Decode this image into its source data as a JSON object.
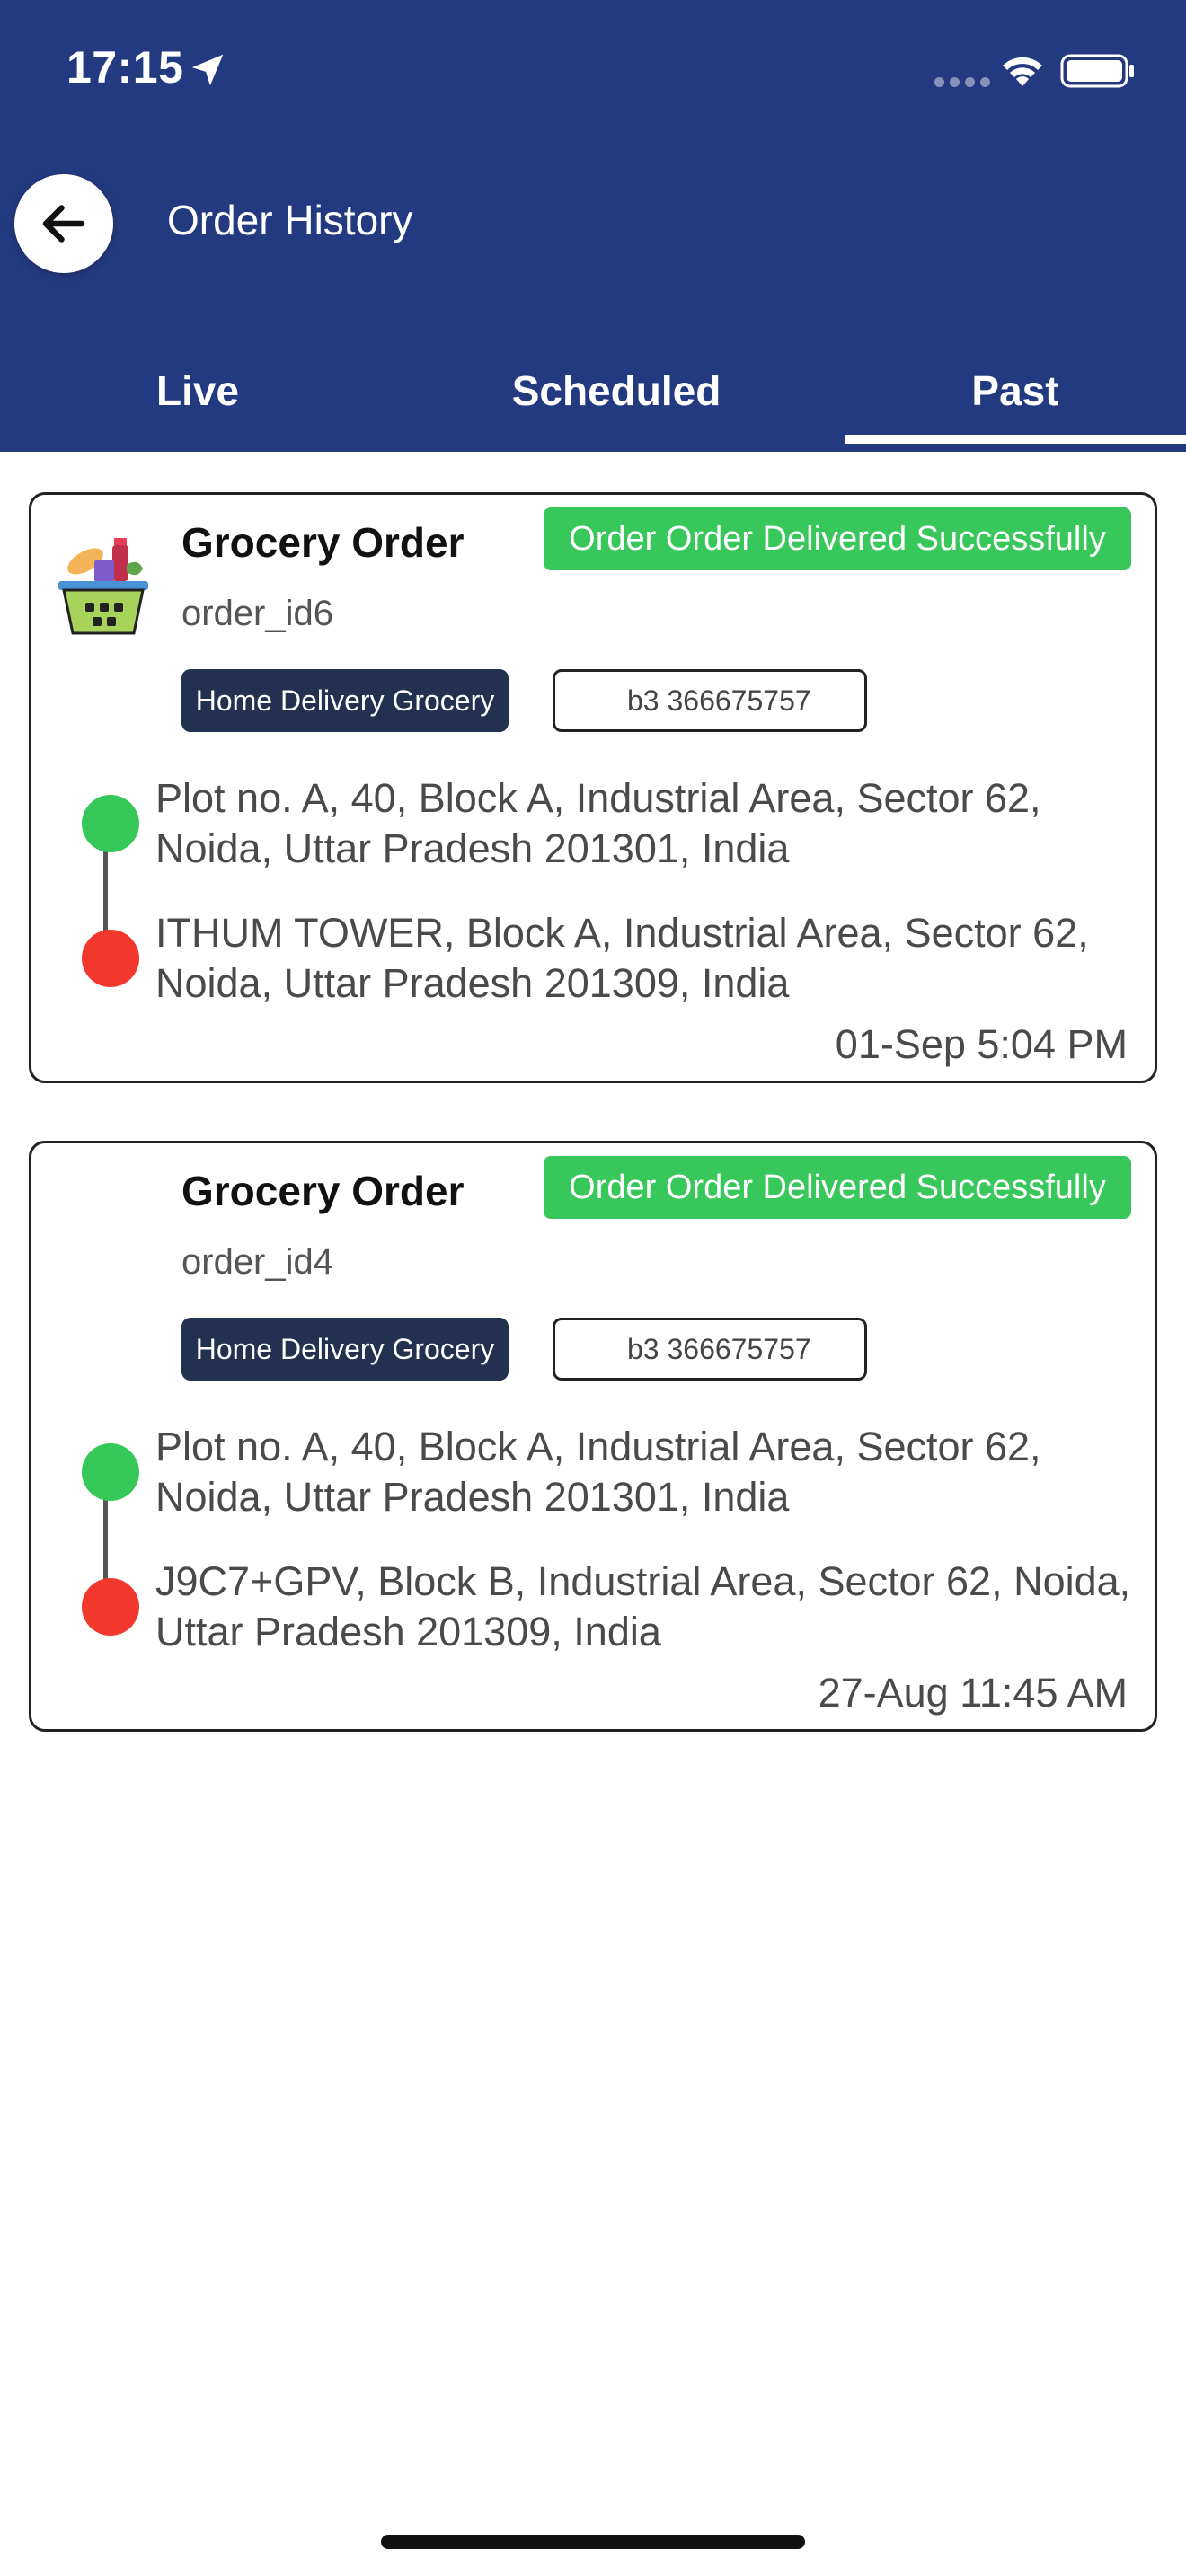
{
  "status_bar": {
    "time": "17:15",
    "icons": [
      "location-arrow-icon",
      "signal-icon",
      "wifi-icon",
      "battery-icon"
    ]
  },
  "header": {
    "title": "Order History",
    "back_icon": "arrow-left-icon",
    "colors": {
      "header_bg": "#243a80",
      "text": "#ffffff"
    }
  },
  "tabs": [
    {
      "label": "Live",
      "selected": false
    },
    {
      "label": "Scheduled",
      "selected": false
    },
    {
      "label": "Past",
      "selected": true
    }
  ],
  "orders": [
    {
      "title": "Grocery Order",
      "order_id": "order_id6",
      "status": "Order Order Delivered Successfully",
      "delivery_type": "Home Delivery Grocery",
      "unit": "b3 366675757",
      "pickup_address": "Plot no. A, 40, Block A, Industrial Area, Sector 62, Noida, Uttar Pradesh 201301, India",
      "drop_address": "ITHUM TOWER, Block A, Industrial Area, Sector 62, Noida, Uttar Pradesh 201309, India",
      "time": "01-Sep 5:04 PM",
      "icon": "grocery-basket-icon"
    },
    {
      "title": "Grocery Order",
      "order_id": "order_id4",
      "status": "Order Order Delivered Successfully",
      "delivery_type": "Home Delivery Grocery",
      "unit": "b3 366675757",
      "pickup_address": "Plot no. A, 40, Block A, Industrial Area, Sector 62, Noida, Uttar Pradesh 201301, India",
      "drop_address": "J9C7+GPV, Block B, Industrial Area, Sector 62, Noida, Uttar Pradesh 201309, India",
      "time": "27-Aug 11:45 AM"
    }
  ],
  "colors": {
    "status_green": "#38c75b",
    "delivery_type_bg": "#22314f",
    "pickup_dot": "#35c758",
    "drop_dot": "#f2382d"
  }
}
